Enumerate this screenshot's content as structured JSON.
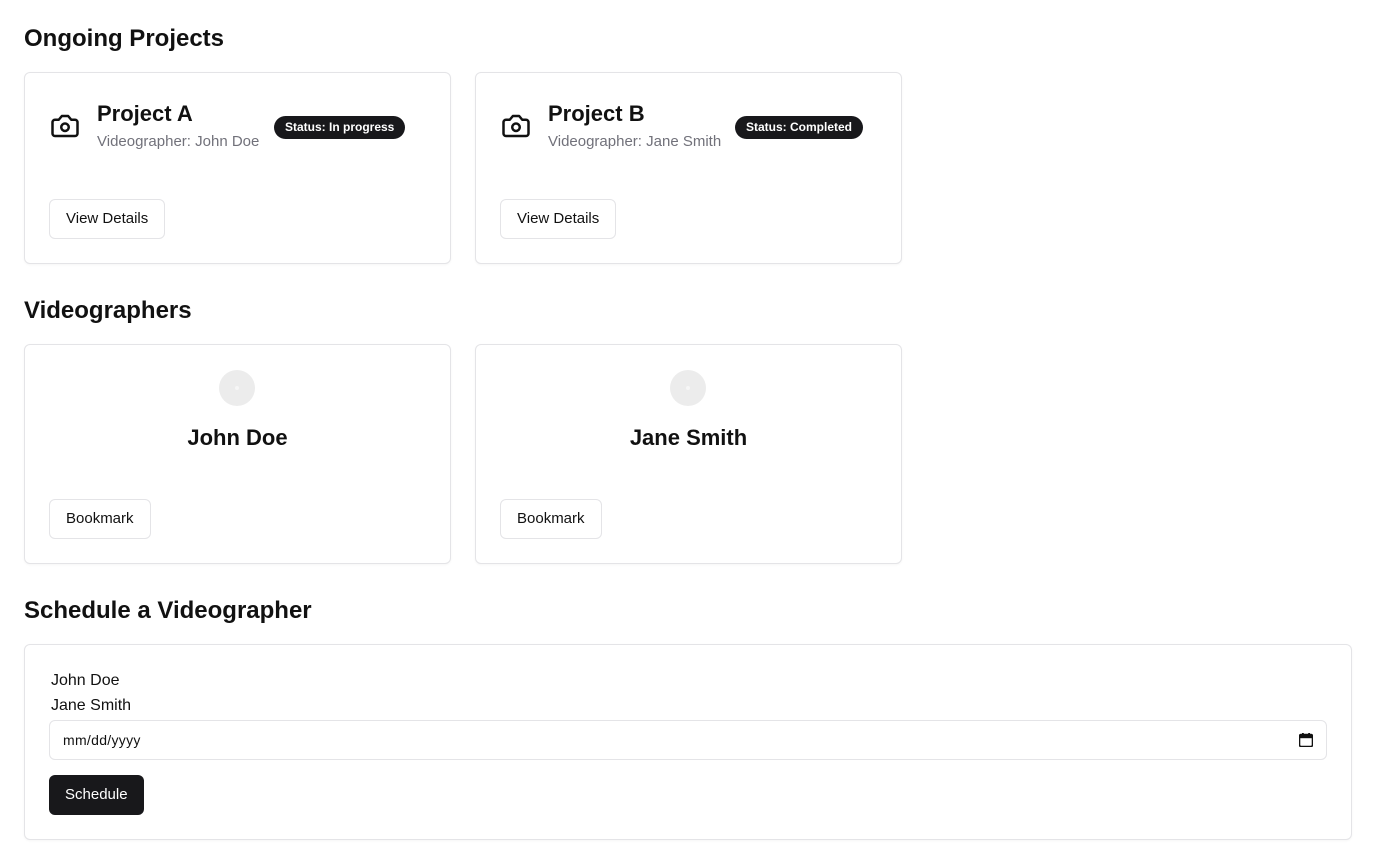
{
  "sections": {
    "ongoing_title": "Ongoing Projects",
    "videographers_title": "Videographers",
    "schedule_title": "Schedule a Videographer"
  },
  "projects": [
    {
      "title": "Project A",
      "videographer": "Videographer: John Doe",
      "status": "Status: In progress",
      "button": "View Details",
      "icon": "camera-icon"
    },
    {
      "title": "Project B",
      "videographer": "Videographer: Jane Smith",
      "status": "Status: Completed",
      "button": "View Details",
      "icon": "camera-icon"
    }
  ],
  "videographers": [
    {
      "name": "John Doe",
      "button": "Bookmark",
      "icon": "avatar"
    },
    {
      "name": "Jane Smith",
      "button": "Bookmark",
      "icon": "avatar"
    }
  ],
  "schedule": {
    "options": [
      "John Doe",
      "Jane Smith"
    ],
    "date_placeholder": "mm/dd/yyyy",
    "button": "Schedule"
  },
  "colors": {
    "badge_bg": "#18181b",
    "primary_button": "#18181b",
    "muted_text": "#71717a",
    "border": "#e4e4e7"
  }
}
